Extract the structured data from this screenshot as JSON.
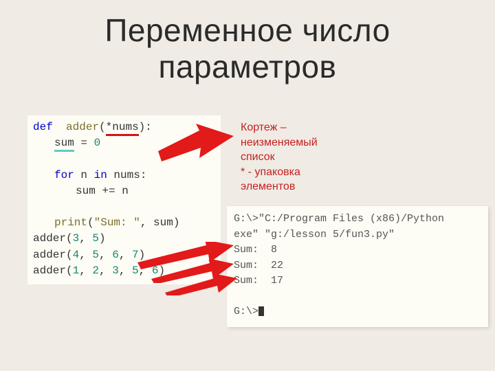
{
  "title_line1": "Переменное число",
  "title_line2": "параметров",
  "code": {
    "l1a": "def",
    "l1b": "adder",
    "l1c": "(",
    "l1d": "*nums",
    "l1e": "):",
    "l2a": "sum",
    "l2b": " = ",
    "l2c": "0",
    "l3a": "for",
    "l3b": " n ",
    "l3c": "in",
    "l3d": " nums:",
    "l4a": "sum += n",
    "l5a": "print",
    "l5b": "(",
    "l5c": "\"Sum: \"",
    "l5d": ", sum)",
    "call1a": "adder(",
    "call1b": "3",
    "call1c": ", ",
    "call1d": "5",
    "call1e": ")",
    "call2a": "adder(",
    "call2b": "4",
    "call2c": ", ",
    "call2d": "5",
    "call2e": ", ",
    "call2f": "6",
    "call2g": ", ",
    "call2h": "7",
    "call2i": ")",
    "call3a": "adder(",
    "call3b": "1",
    "call3c": ", ",
    "call3d": "2",
    "call3e": ", ",
    "call3f": "3",
    "call3g": ", ",
    "call3h": "5",
    "call3i": ", ",
    "call3j": "6",
    "call3k": ")"
  },
  "note": {
    "l1": "Кортеж –",
    "l2": "неизменяемый",
    "l3": "список",
    "l4": "* - упаковка",
    "l5": "элементов"
  },
  "console": {
    "l1": "G:\\>\"C:/Program Files (x86)/Python",
    "l2": "exe\" \"g:/lesson 5/fun3.py\"",
    "l3": "Sum:  8",
    "l4": "Sum:  22",
    "l5": "Sum:  17",
    "l6": "",
    "l7": "G:\\>"
  }
}
